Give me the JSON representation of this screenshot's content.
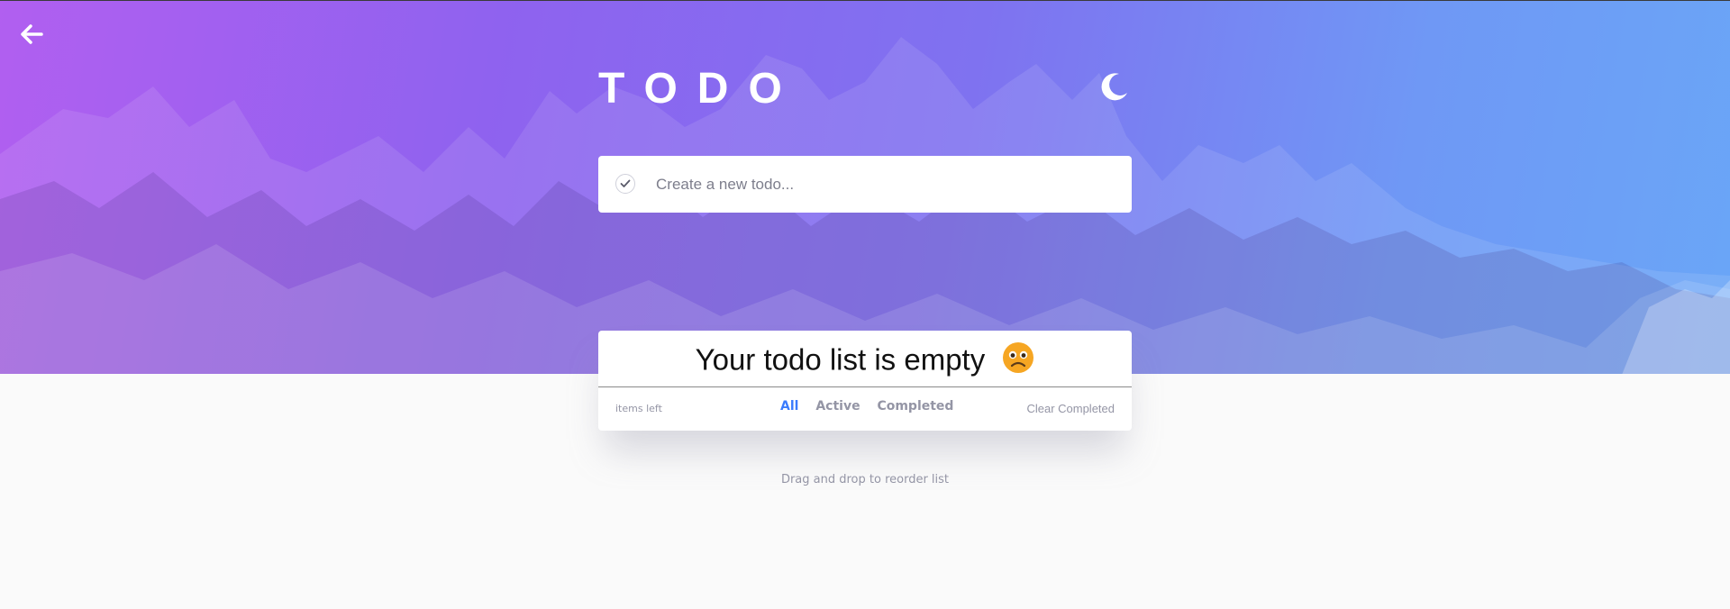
{
  "header": {
    "title": "TODO",
    "back_icon": "arrow-left-icon",
    "theme_icon": "moon-icon"
  },
  "new_todo": {
    "placeholder": "Create a new todo...",
    "value": "",
    "check_icon": "check-icon"
  },
  "list": {
    "empty_message": "Your todo list is empty",
    "empty_icon": "sad-face-icon"
  },
  "footer": {
    "items_left": "items left",
    "filters": [
      "All",
      "Active",
      "Completed"
    ],
    "active_filter": "All",
    "clear_label": "Clear Completed"
  },
  "hint": "Drag and drop to reorder list",
  "colors": {
    "accent": "#3a7bfd",
    "muted": "#9495a5",
    "gradient_start": "#b15ff0",
    "gradient_end": "#6aa6f7",
    "page_bg": "#fafafa"
  }
}
